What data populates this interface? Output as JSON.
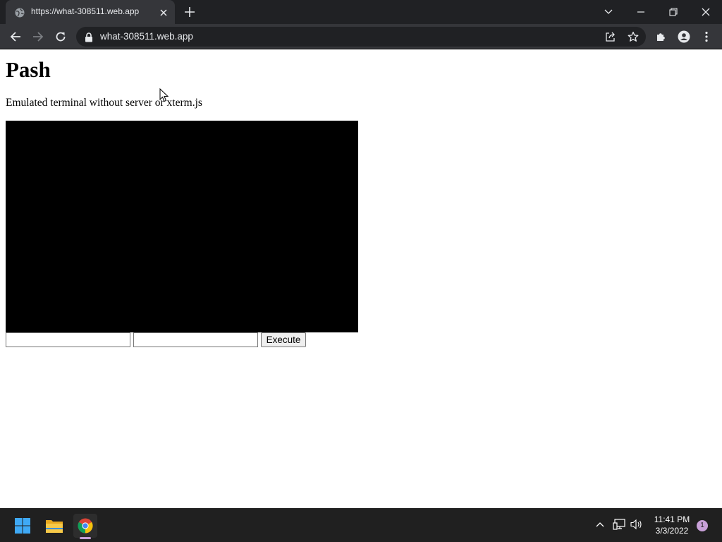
{
  "browser": {
    "tab_title": "https://what-308511.web.app",
    "url": "what-308511.web.app"
  },
  "page": {
    "heading": "Pash",
    "subtitle": "Emulated terminal without server or xterm.js",
    "input1": {
      "value": "",
      "placeholder": ""
    },
    "input2": {
      "value": "",
      "placeholder": ""
    },
    "execute_label": "Execute"
  },
  "taskbar": {
    "time": "11:41 PM",
    "date": "3/3/2022",
    "notification_count": "1"
  },
  "colors": {
    "chrome_dark": "#202124",
    "chrome_mid": "#35363a",
    "terminal_bg": "#000000",
    "taskbar_bg": "#202020",
    "accent": "#c8a0d8"
  },
  "icons": [
    "globe-icon",
    "close-icon",
    "plus-icon",
    "chevron-down-icon",
    "minimize-icon",
    "restore-icon",
    "window-close-icon",
    "back-icon",
    "forward-icon",
    "reload-icon",
    "lock-icon",
    "share-icon",
    "star-icon",
    "extensions-icon",
    "profile-icon",
    "kebab-menu-icon",
    "windows-start-icon",
    "file-explorer-icon",
    "chrome-icon",
    "chevron-up-icon",
    "network-icon",
    "volume-icon"
  ]
}
